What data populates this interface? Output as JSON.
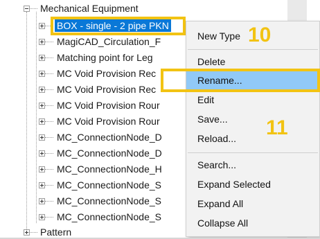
{
  "tree": {
    "parent_label": "Mechanical Equipment",
    "children": [
      "BOX - single - 2 pipe PKN",
      "MagiCAD_Circulation_F",
      "Matching point for Leg",
      "MC Void Provision Rec",
      "MC Void Provision Rec",
      "MC Void Provision Rour",
      "MC Void Provision Rour",
      "MC_ConnectionNode_D",
      "MC_ConnectionNode_D",
      "MC_ConnectionNode_H",
      "MC_ConnectionNode_S",
      "MC_ConnectionNode_S",
      "MC_ConnectionNode_S"
    ],
    "sibling_label": "Pattern",
    "selection_color": "#0A78D7"
  },
  "context_menu": {
    "items": [
      "New Type",
      "Delete",
      "Rename...",
      "Edit",
      "Save...",
      "Reload...",
      "Search...",
      "Expand Selected",
      "Expand All",
      "Collapse All"
    ],
    "hovered_item": "Rename...",
    "hover_color": "#91C9F7"
  },
  "annotations": {
    "step_a": "10",
    "step_b": "11",
    "color": "#F2C313"
  }
}
